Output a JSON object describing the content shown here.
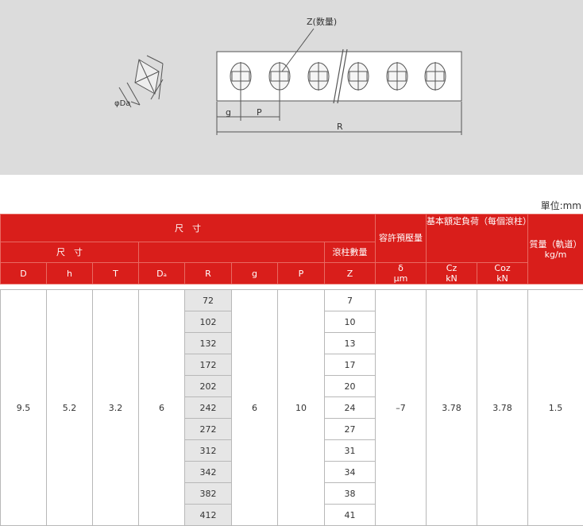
{
  "diagram": {
    "z_label": "Z(数量)",
    "da_label": "φDa",
    "g_label": "g",
    "p_label": "P",
    "r_label": "R"
  },
  "unit_label": "單位:mm",
  "table": {
    "header": {
      "dimensions": "尺　寸",
      "sub_dimensions": "尺　寸",
      "roller_count": "滾柱數量",
      "preload": "容許預壓量",
      "preload_symbol": "δ",
      "preload_unit": "μm",
      "load_rating": "基本額定負荷（每個滾柱）",
      "mass": "質量（軌道）",
      "mass_unit": "kg/m",
      "col_D": "D",
      "col_h": "h",
      "col_T": "T",
      "col_Da": "Dₐ",
      "col_R": "R",
      "col_g": "g",
      "col_P": "P",
      "col_Z": "Z",
      "col_C": "Cz",
      "col_C0": "Coz",
      "kn_unit": "kN"
    },
    "values": {
      "D": "9.5",
      "h": "5.2",
      "T": "3.2",
      "Da": "6",
      "g": "6",
      "P": "10",
      "delta": "–7",
      "C": "3.78",
      "C0": "3.78",
      "mass": "1.5"
    },
    "rows": [
      {
        "R": "72",
        "Z": "7"
      },
      {
        "R": "102",
        "Z": "10"
      },
      {
        "R": "132",
        "Z": "13"
      },
      {
        "R": "172",
        "Z": "17"
      },
      {
        "R": "202",
        "Z": "20"
      },
      {
        "R": "242",
        "Z": "24"
      },
      {
        "R": "272",
        "Z": "27"
      },
      {
        "R": "312",
        "Z": "31"
      },
      {
        "R": "342",
        "Z": "34"
      },
      {
        "R": "382",
        "Z": "38"
      },
      {
        "R": "412",
        "Z": "41"
      }
    ]
  },
  "colors": {
    "header_red": "#d91e1b",
    "diagram_bg": "#dcdcdc",
    "r_cell_bg": "#e6e6e6"
  }
}
